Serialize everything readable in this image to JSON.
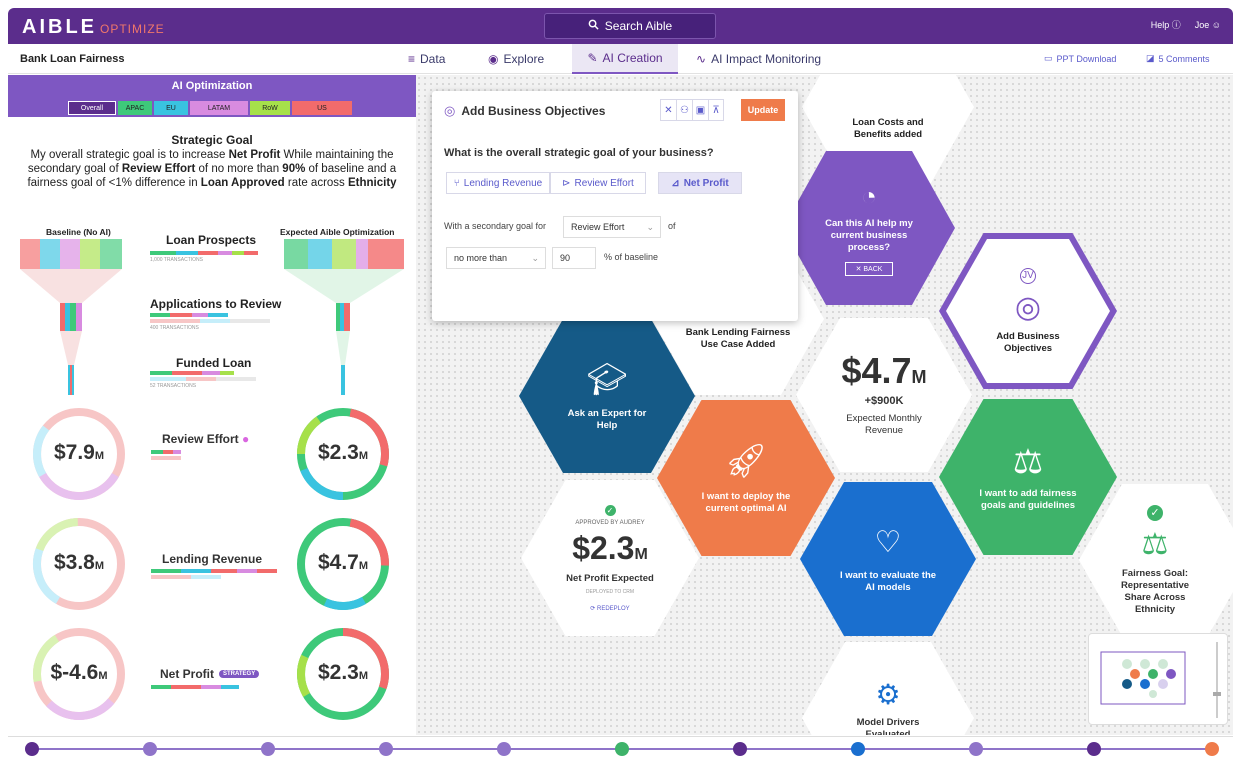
{
  "app": {
    "logo": "AIBLE",
    "logo_suffix": "OPTIMIZE",
    "search_placeholder": "Search Aible",
    "help": "Help",
    "user": "Joe"
  },
  "nav": {
    "project": "Bank Loan Fairness",
    "tabs": [
      "Data",
      "Explore",
      "AI Creation",
      "AI Impact Monitoring"
    ],
    "active_tab": "AI Creation",
    "ppt": "PPT Download",
    "comments": "5 Comments"
  },
  "left": {
    "title": "AI Optimization",
    "regions": [
      "Overall",
      "APAC",
      "EU",
      "LATAM",
      "RoW",
      "US"
    ],
    "strategic_title": "Strategic Goal",
    "strategic_text": {
      "p1": "My overall strategic goal is to increase ",
      "b1": "Net Profit",
      "p2": "  While maintaining the secondary goal of ",
      "b2": "Review Effort",
      "p3": " of no more than ",
      "b3": "90%",
      "p4": " of baseline and a fairness goal of <1% difference in ",
      "b4": "Loan Approved",
      "p5": " rate across ",
      "b5": "Ethnicity"
    },
    "baseline_label": "Baseline (No AI)",
    "expected_label": "Expected Aible Optimization",
    "stages": [
      {
        "name": "Loan Prospects",
        "sub": "1,000 TRANSACTIONS"
      },
      {
        "name": "Applications to Review",
        "sub": "400 TRANSACTIONS"
      },
      {
        "name": "Funded Loan",
        "sub": "52 TRANSACTIONS"
      }
    ],
    "metrics": [
      {
        "name": "Review Effort",
        "baseline": "$7.9",
        "expected": "$2.3",
        "unit": "M"
      },
      {
        "name": "Lending Revenue",
        "baseline": "$3.8",
        "expected": "$4.7",
        "unit": "M"
      },
      {
        "name": "Net Profit",
        "baseline": "$-4.6",
        "expected": "$2.3",
        "unit": "M",
        "badge": "STRATEGY"
      }
    ]
  },
  "popup": {
    "title": "Add Business Objectives",
    "update": "Update",
    "question": "What is the overall strategic goal of your business?",
    "options": [
      "Lending Revenue",
      "Review Effort",
      "Net Profit"
    ],
    "selected": "Net Profit",
    "secondary_prefix": "With a secondary goal for",
    "secondary_value": "Review Effort",
    "of": "of",
    "constraint": "no more than",
    "percent": "90",
    "pct_suffix": "% of baseline"
  },
  "hexes": {
    "loan_costs": "Loan Costs and Benefits added",
    "can_help": "Can this AI help my current business process?",
    "back": "BACK",
    "add_obj": "Add Business Objectives",
    "bank_fairness": "Bank Lending Fairness Use Case Added",
    "revenue_big": "$4.7",
    "revenue_unit": "M",
    "revenue_delta": "+$900K",
    "revenue_label": "Expected Monthly Revenue",
    "expert": "Ask an Expert for Help",
    "deploy": "I want to deploy the current optimal AI",
    "fairness_goals": "I want to add fairness goals and guidelines",
    "approved": "APPROVED BY AUDREY",
    "profit_big": "$2.3",
    "profit_unit": "M",
    "profit_label": "Net Profit Expected",
    "deployed": "DEPLOYED TO CRM",
    "redeploy": "REDEPLOY",
    "evaluate": "I want to evaluate the AI models",
    "fairness_goal": "Fairness Goal: Representative Share Across Ethnicity",
    "drivers": "Model Drivers Evaluated"
  },
  "colors": {
    "brand": "#5b2d8c",
    "accent": "#7e57c2",
    "orange": "#ef7b4a",
    "green": "#3eb36a",
    "blue": "#1a6fcf",
    "navy": "#155a87"
  }
}
